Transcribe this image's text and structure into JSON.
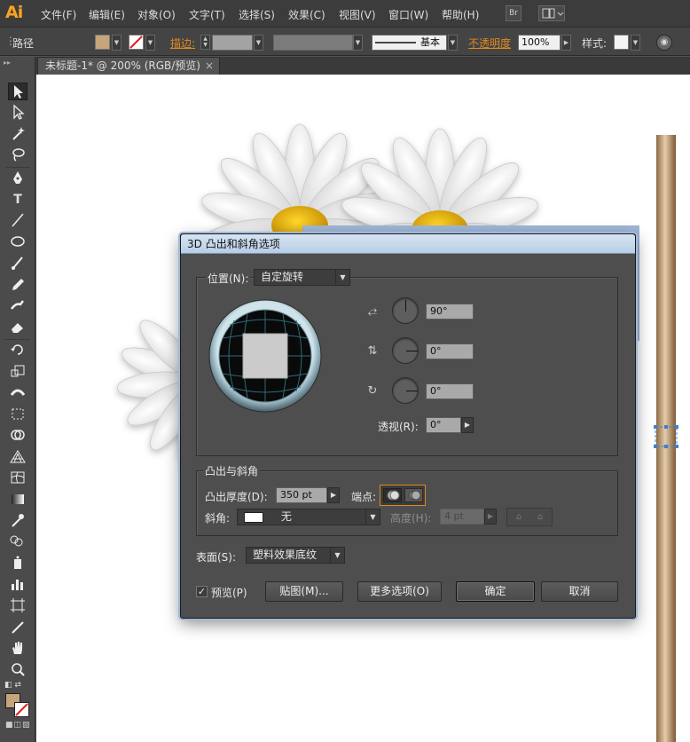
{
  "app": {
    "logo": "Ai",
    "menu": [
      "文件(F)",
      "编辑(E)",
      "对象(O)",
      "文字(T)",
      "选择(S)",
      "效果(C)",
      "视图(V)",
      "窗口(W)",
      "帮助(H)"
    ],
    "bridge_label": "Br"
  },
  "control_bar": {
    "object_label": "路径",
    "stroke_label": "描边:",
    "stroke_style": "基本",
    "opacity_label": "不透明度",
    "opacity_value": "100%",
    "style_label": "样式:",
    "fill_color": "#c5a57a"
  },
  "tab": {
    "title": "未标题-1* @ 200% (RGB/预览)",
    "close": "×"
  },
  "dialog": {
    "title": "3D 凸出和斜角选项",
    "position_label": "位置(N):",
    "position_value": "自定旋转",
    "rot_x": "90°",
    "rot_y": "0°",
    "rot_z": "0°",
    "perspective_label": "透视(R):",
    "perspective_value": "0°",
    "extrude_group_label": "凸出与斜角",
    "extrude_depth_label": "凸出厚度(D):",
    "extrude_depth_value": "350 pt",
    "cap_label": "端点:",
    "bevel_label": "斜角:",
    "bevel_value": "无",
    "height_label": "高度(H):",
    "height_value": "4 pt",
    "surface_label": "表面(S):",
    "surface_value": "塑料效果底纹",
    "preview_label": "预览(P)",
    "preview_checked": true,
    "map_button": "贴图(M)...",
    "more_options_button": "更多选项(O)",
    "ok_button": "确定",
    "cancel_button": "取消"
  },
  "colors": {
    "accent_orange": "#e08a1e",
    "dialog_title_bg": "#c9d9ec",
    "canvas_bg": "#ffffff"
  }
}
